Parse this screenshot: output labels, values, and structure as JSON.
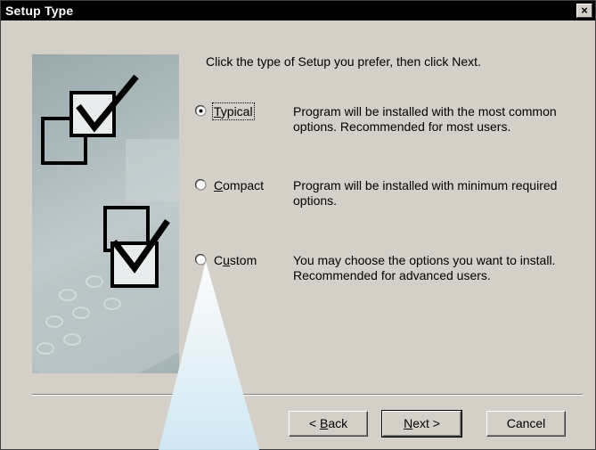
{
  "window": {
    "title": "Setup Type",
    "close_label": "×"
  },
  "prompt": "Click the type of Setup you prefer, then click Next.",
  "options": [
    {
      "label": "Typical",
      "mnemonic": "T",
      "rest": "ypical",
      "selected": true,
      "description": "Program will be installed with the most common options.  Recommended for most users."
    },
    {
      "label": "Compact",
      "mnemonic": "C",
      "rest": "ompact",
      "selected": false,
      "description": "Program will be installed with minimum required options."
    },
    {
      "label": "Custom",
      "mnemonic": "u",
      "pre": "C",
      "rest": "stom",
      "selected": false,
      "description": "You may choose the options you want to install. Recommended for advanced users."
    }
  ],
  "buttons": {
    "back": {
      "pre": "< ",
      "mnemonic": "B",
      "rest": "ack"
    },
    "next": {
      "mnemonic": "N",
      "rest": "ext >"
    },
    "cancel": "Cancel"
  },
  "colors": {
    "dialog_bg": "#d4d0c8",
    "titlebar_bg": "#000000",
    "spotlight": "#cfe9f5"
  }
}
